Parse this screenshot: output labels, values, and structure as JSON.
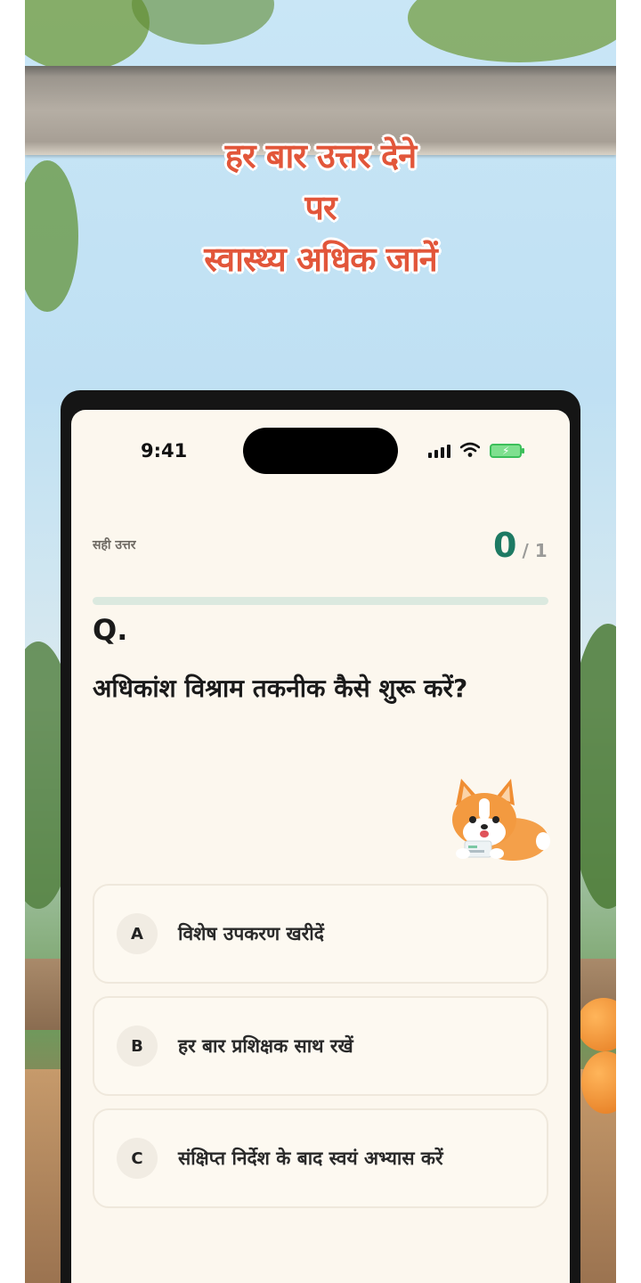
{
  "headline": {
    "line1": "हर बार उत्तर देने",
    "line2": "पर",
    "line3": "स्वास्थ्य अधिक जानें"
  },
  "status_bar": {
    "time": "9:41"
  },
  "quiz": {
    "score_label": "सही उत्तर",
    "score_value": "0",
    "score_total": "/ 1",
    "progress": 0,
    "question_mark": "Q.",
    "question_text": "अधिकांश विश्राम तकनीक कैसे शुरू करें?",
    "options": [
      {
        "letter": "A",
        "text": "विशेष उपकरण खरीदें"
      },
      {
        "letter": "B",
        "text": "हर बार प्रशिक्षक साथ रखें"
      },
      {
        "letter": "C",
        "text": "संक्षिप्त निर्देश के बाद स्वयं अभ्यास करें"
      }
    ]
  },
  "colors": {
    "headline": "#e2563a",
    "accent_green": "#1d7a63",
    "screen_bg": "#fcf7ee"
  },
  "icons": [
    "signal-icon",
    "wifi-icon",
    "battery-icon",
    "corgi-mascot"
  ]
}
